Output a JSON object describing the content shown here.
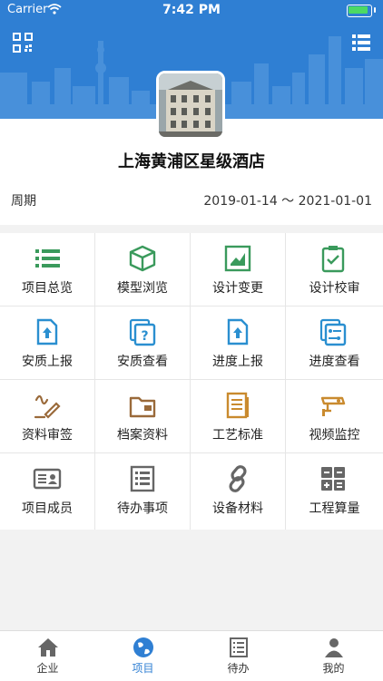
{
  "status_bar": {
    "carrier": "Carrier",
    "time": "7:42 PM"
  },
  "header": {
    "scan_icon": "qr-code-icon",
    "menu_icon": "list-icon"
  },
  "project": {
    "title": "上海黄浦区星级酒店",
    "period_label": "周期",
    "period_value": "2019-01-14 ～ 2021-01-01"
  },
  "grid": [
    {
      "label": "项目总览",
      "icon": "list-icon",
      "color": "#3a9a5c"
    },
    {
      "label": "模型浏览",
      "icon": "cube-icon",
      "color": "#3a9a5c"
    },
    {
      "label": "设计变更",
      "icon": "image-edit-icon",
      "color": "#3a9a5c"
    },
    {
      "label": "设计校审",
      "icon": "clipboard-check-icon",
      "color": "#3a9a5c"
    },
    {
      "label": "安质上报",
      "icon": "doc-upload-icon",
      "color": "#2a8fd0"
    },
    {
      "label": "安质查看",
      "icon": "doc-question-icon",
      "color": "#2a8fd0"
    },
    {
      "label": "进度上报",
      "icon": "doc-upload-icon",
      "color": "#2a8fd0"
    },
    {
      "label": "进度查看",
      "icon": "doc-progress-icon",
      "color": "#2a8fd0"
    },
    {
      "label": "资料审签",
      "icon": "signature-icon",
      "color": "#9a6a3a"
    },
    {
      "label": "档案资料",
      "icon": "folder-icon",
      "color": "#9a6a3a"
    },
    {
      "label": "工艺标准",
      "icon": "document-icon",
      "color": "#c98a2e"
    },
    {
      "label": "视频监控",
      "icon": "camera-icon",
      "color": "#c98a2e"
    },
    {
      "label": "项目成员",
      "icon": "id-card-icon",
      "color": "#666666"
    },
    {
      "label": "待办事项",
      "icon": "todo-list-icon",
      "color": "#666666"
    },
    {
      "label": "设备材料",
      "icon": "link-icon",
      "color": "#666666"
    },
    {
      "label": "工程算量",
      "icon": "calculator-icon",
      "color": "#666666"
    }
  ],
  "tabs": [
    {
      "label": "企业",
      "icon": "home-icon",
      "active": false
    },
    {
      "label": "项目",
      "icon": "globe-icon",
      "active": true
    },
    {
      "label": "待办",
      "icon": "todo-icon",
      "active": false
    },
    {
      "label": "我的",
      "icon": "user-icon",
      "active": false
    }
  ],
  "colors": {
    "primary": "#2f7fd3",
    "active_tab": "#2f7fd3"
  }
}
